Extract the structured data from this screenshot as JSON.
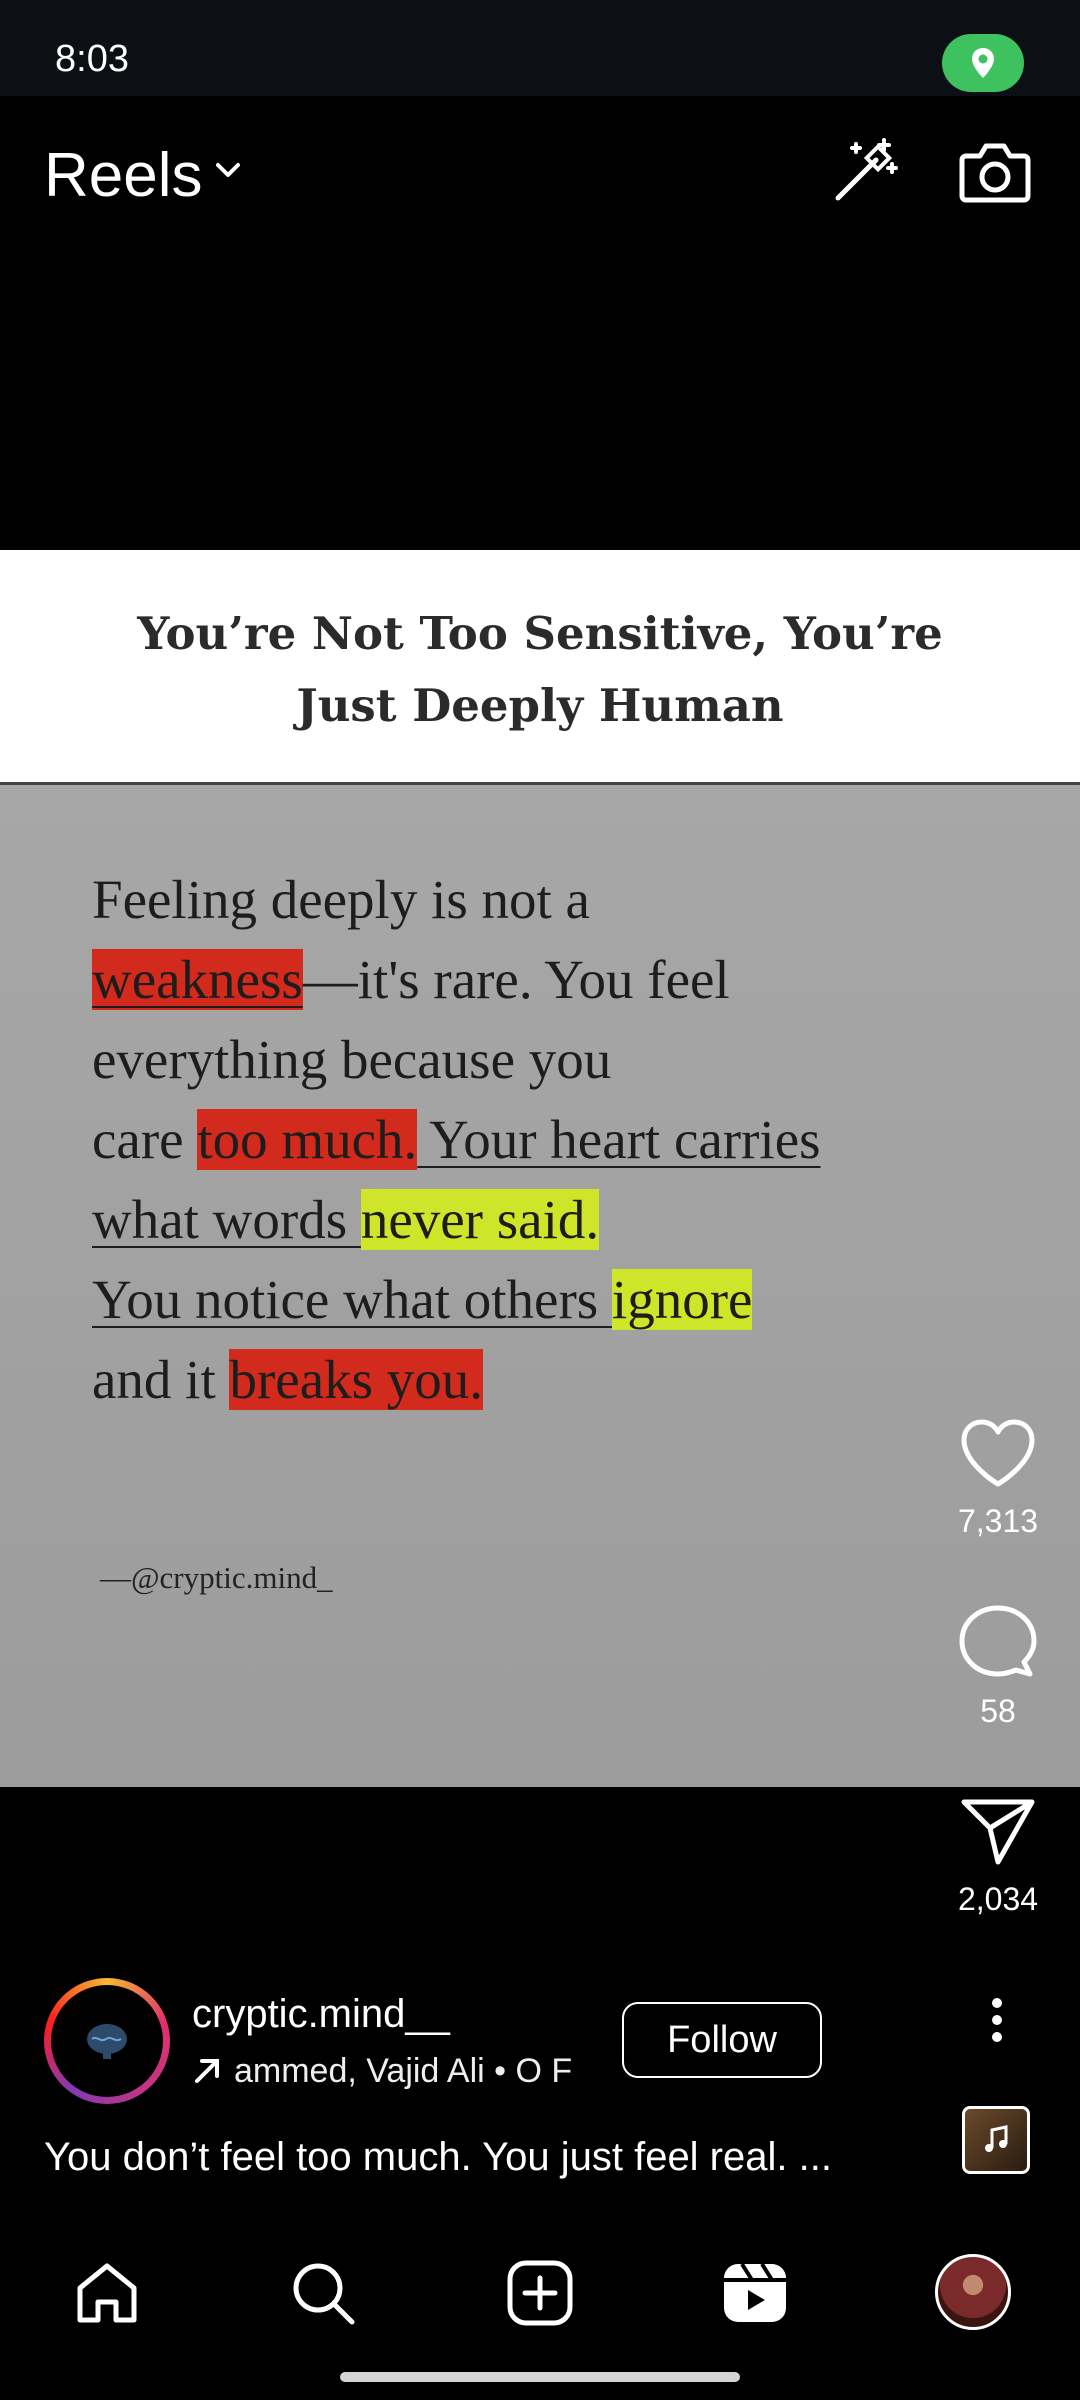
{
  "status_bar": {
    "time": "8:03"
  },
  "header": {
    "title": "Reels"
  },
  "post": {
    "heading_line1": "You’re Not Too Sensitive, You’re",
    "heading_line2": "Just Deeply Human",
    "quote": {
      "l1": "Feeling deeply is not a",
      "l2a": "weakness",
      "l2b": "—it's rare. You feel",
      "l3": "everything because you",
      "l4a": "care ",
      "l4b": "too much.",
      "l4c": " Your heart carries",
      "l5a": "what words ",
      "l5b": "never said.",
      "l6a": "You notice what others ",
      "l6b": "ignore",
      "l7a": "and it ",
      "l7b": "breaks you."
    },
    "credit": "—@cryptic.mind_"
  },
  "actions": {
    "likes": "7,313",
    "comments": "58",
    "shares": "2,034"
  },
  "author": {
    "username": "cryptic.mind__",
    "tagged": "ammed, Vajid Ali  •  O F",
    "follow_label": "Follow",
    "caption": "You don’t feel too much. You just feel real. ..."
  },
  "colors": {
    "highlight_red": "#d22a1c",
    "highlight_yellow": "#cfe52a",
    "status_green": "#3dc25f"
  }
}
